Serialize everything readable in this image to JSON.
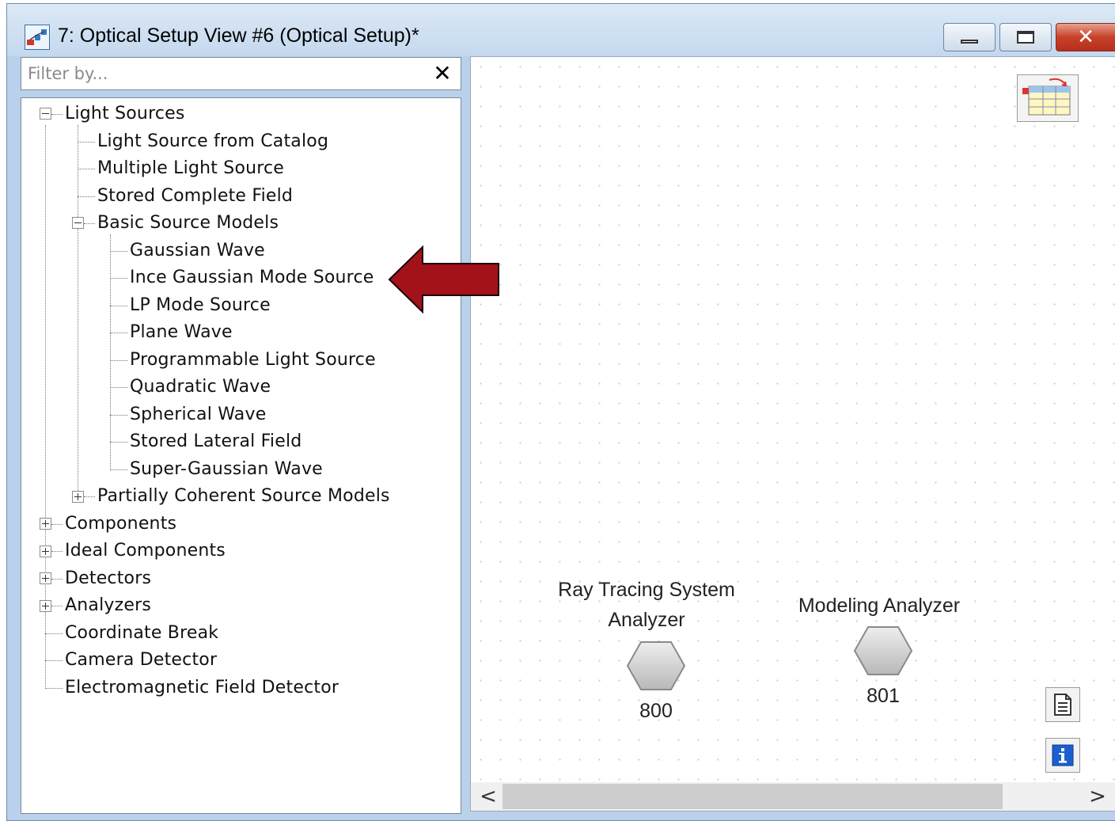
{
  "window": {
    "title": "7: Optical Setup View #6 (Optical Setup)*",
    "close_symbol": "✕"
  },
  "filter": {
    "placeholder": "Filter by...",
    "clear_symbol": "✕"
  },
  "tree": {
    "light_sources": "Light Sources",
    "light_source_from_catalog": "Light Source from Catalog",
    "multiple_light_source": "Multiple Light Source",
    "stored_complete_field": "Stored Complete Field",
    "basic_source_models": "Basic Source Models",
    "gaussian_wave": "Gaussian Wave",
    "ince_gaussian_mode_source": "Ince Gaussian Mode Source",
    "lp_mode_source": "LP Mode Source",
    "plane_wave": "Plane Wave",
    "programmable_light_source": "Programmable Light Source",
    "quadratic_wave": "Quadratic Wave",
    "spherical_wave": "Spherical Wave",
    "stored_lateral_field": "Stored Lateral Field",
    "super_gaussian_wave": "Super-Gaussian Wave",
    "partially_coherent_source_models": "Partially Coherent Source Models",
    "components": "Components",
    "ideal_components": "Ideal Components",
    "detectors": "Detectors",
    "analyzers": "Analyzers",
    "coordinate_break": "Coordinate Break",
    "camera_detector": "Camera Detector",
    "electromagnetic_field_detector": "Electromagnetic Field Detector"
  },
  "canvas": {
    "nodes": [
      {
        "label_line1": "Ray Tracing System",
        "label_line2": "Analyzer",
        "id": "800"
      },
      {
        "label_line1": "Modeling Analyzer",
        "id": "801"
      }
    ],
    "scroll_left": "<",
    "scroll_right": ">"
  },
  "colors": {
    "highlight_arrow": "#a3111a",
    "window_frame": "#b9d1ea",
    "hex_fill": "#d6d6d6",
    "info_blue": "#1a5fd0"
  },
  "icons": [
    "optical-setup-icon",
    "restore-icon",
    "minimize-icon",
    "maximize-icon",
    "close-icon",
    "clear-filter-icon",
    "palette-table-icon",
    "document-icon",
    "info-icon",
    "red-arrow-icon"
  ]
}
